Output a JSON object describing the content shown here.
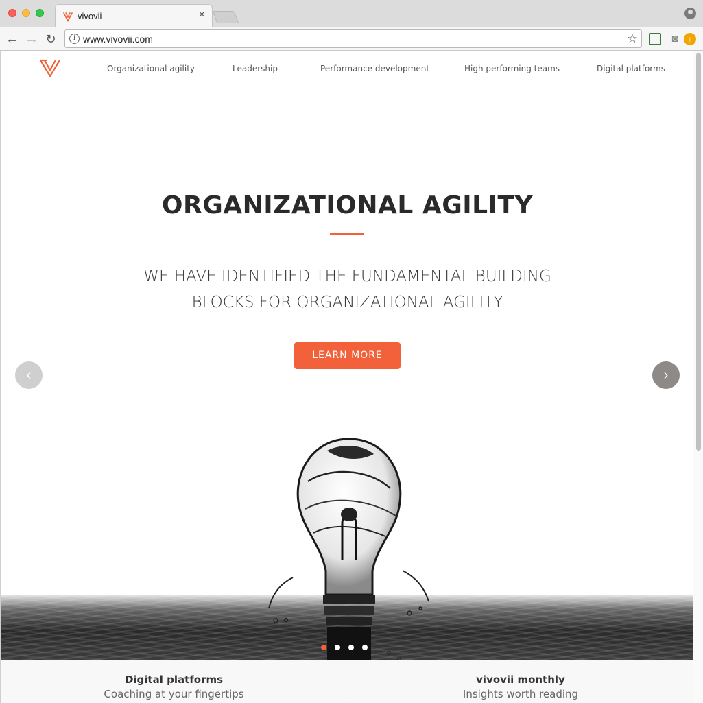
{
  "browser": {
    "tab_title": "vivovii",
    "tab_close": "×",
    "url": "www.vivovii.com",
    "back": "←",
    "forward": "→",
    "reload": "↻",
    "star": "☆",
    "info": "i",
    "accent": "#f26139"
  },
  "site": {
    "nav": [
      "Organizational agility",
      "Leadership",
      "Performance development",
      "High performing teams",
      "Digital platforms"
    ]
  },
  "hero": {
    "title": "ORGANIZATIONAL AGILITY",
    "subtitle_line1": "WE HAVE IDENTIFIED THE FUNDAMENTAL BUILDING",
    "subtitle_line2": "BLOCKS FOR ORGANIZATIONAL AGILITY",
    "cta_label": "LEARN MORE",
    "prev": "‹",
    "next": "›",
    "slides_total": 4,
    "active_slide": 1
  },
  "cards": [
    {
      "title": "Digital platforms",
      "subtitle": "Coaching at your fingertips"
    },
    {
      "title": "vivovii monthly",
      "subtitle": "Insights worth reading"
    }
  ]
}
